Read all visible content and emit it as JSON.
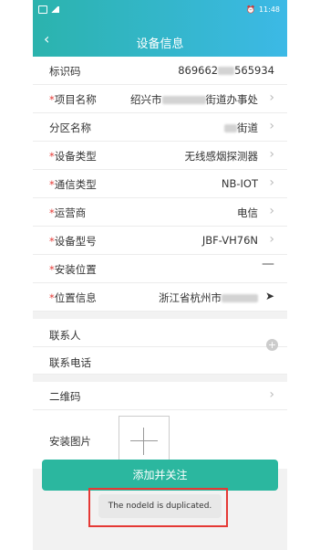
{
  "status_bar": {
    "time": "11:48"
  },
  "header": {
    "title": "设备信息"
  },
  "fields": [
    {
      "label": "标识码",
      "required": false,
      "value": "869662",
      "value_suffix": "565934",
      "blur_width": 18
    },
    {
      "label": "项目名称",
      "required": true,
      "value": "绍兴市",
      "value_suffix": "街道办事处",
      "blur_width": 48
    },
    {
      "label": "分区名称",
      "required": false,
      "value": "",
      "value_suffix": "街道",
      "blur_width": 14
    },
    {
      "label": "设备类型",
      "required": true,
      "value": "无线感烟探测器",
      "value_suffix": "",
      "blur_width": 0
    },
    {
      "label": "通信类型",
      "required": true,
      "value": "NB-IOT",
      "value_suffix": "",
      "blur_width": 0
    },
    {
      "label": "运营商",
      "required": true,
      "value": "电信",
      "value_suffix": "",
      "blur_width": 0
    },
    {
      "label": "设备型号",
      "required": true,
      "value": "JBF-VH76N",
      "value_suffix": "",
      "blur_width": 0
    },
    {
      "label": "安装位置",
      "required": true,
      "value": "",
      "value_suffix": "",
      "blur_width": 0
    },
    {
      "label": "位置信息",
      "required": true,
      "value": "浙江省杭州市",
      "value_suffix": "",
      "blur_width": 40
    }
  ],
  "contact": {
    "person_label": "联系人",
    "phone_label": "联系电话"
  },
  "qr": {
    "label": "二维码"
  },
  "install_photo": {
    "label": "安装图片"
  },
  "submit_button": "添加并关注",
  "toast": "The nodeId is duplicated."
}
